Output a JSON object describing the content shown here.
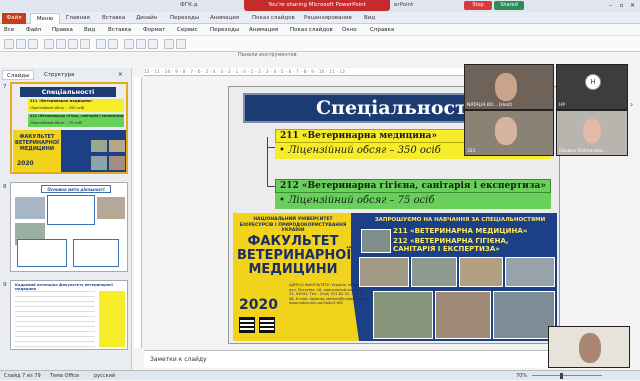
{
  "window": {
    "title": "ФГК.д",
    "title_suffix": "erPoint",
    "share_banner": "You're sharing Microsoft PowerPoint",
    "stop_label": "Stop",
    "shared_label": "Shared"
  },
  "ribbon": {
    "file": "Файл",
    "tabs": [
      "Меню",
      "Главная",
      "Вставка",
      "Дизайн",
      "Переходы",
      "Анимация",
      "Показ слайдов",
      "Рецензирование",
      "Вид"
    ]
  },
  "menu": {
    "items": [
      "Все",
      "Файл",
      "Правка",
      "Вид",
      "Вставка",
      "Формат",
      "Сервис",
      "Переходы",
      "Анимация",
      "Показ слайдов",
      "Окно",
      "Справка"
    ]
  },
  "toolbar": {
    "panel_label": "Панели инструментов"
  },
  "slides_panel": {
    "tabs": [
      "Слайды",
      "Структура"
    ],
    "numbers": [
      "7",
      "8",
      "9"
    ],
    "thumb7": {
      "title": "Спеціальності",
      "line1": "211 «Ветеринарна медицина»",
      "line2": "Ліцензійний обсяг – 350 осіб",
      "line3": "212 «Ветеринарна гігієна, санітарія і експертиза»",
      "line4": "Ліцензійний обсяг – 75 осіб",
      "fac": "ФАКУЛЬТЕТ ВЕТЕРИНАРНОЇ МЕДИЦИНИ",
      "year": "2020"
    },
    "thumb8": {
      "title": "Основна мета діяльності"
    },
    "thumb9": {
      "title": "Кадровий потенціал факультету ветеринарної медицини"
    }
  },
  "ruler": {
    "marks": "12 · 11 · 10 · 9 · 8 · 7 · 6 · 5 · 4 · 3 · 2 · 1 · 0 · 1 · 2 · 3 · 4 · 5 · 6 · 7 · 8 · 9 · 10 · 11 · 12"
  },
  "slide": {
    "title": "Спеціальності",
    "spec1_title": "211 «Ветеринарна медицина»",
    "spec1_sub": "• Ліцензійний обсяг – 350 осіб",
    "spec2_title": "212 «Ветеринарна гігієна, санітарія і експертиза»",
    "spec2_sub": "• Ліцензійний обсяг – 75 осіб",
    "poster": {
      "university": "НАЦІОНАЛЬНИЙ УНІВЕРСИТЕТ БІОРЕСУРСІВ І ПРИРОДОКОРИСТУВАННЯ УКРАЇНИ",
      "faculty": "ФАКУЛЬТЕТ ВЕТЕРИНАРНОЇ МЕДИЦИНИ",
      "year": "2020",
      "invite": "ЗАПРОШУЄМО НА НАВЧАННЯ ЗА СПЕЦІАЛЬНОСТЯМИ",
      "spec211": "211 «ВЕТЕРИНАРНА МЕДИЦИНА»",
      "spec212": "212 «ВЕТЕРИНАРНА ГІГІЄНА, САНІТАРІЯ І ЕКСПЕРТИЗА»",
      "address": "АДРЕСА ФАКУЛЬТЕТУ: Україна, м. Київ, вул. Потєхіна, 16, навчальний корпус № 12, 03041, Тел.: (044) 527-82-31, 527-82-58, E-mail: dekanat_vetmed@nubip.edu.ua, www.nubip.edu.ua/node/1160"
    }
  },
  "notes": {
    "placeholder": "Заметки к слайду"
  },
  "video": {
    "p1": "NATALIA KO... (Host)",
    "p2": "HP",
    "p2_initial": "H",
    "p3": "321",
    "p4": "Oksana Vishnevska..."
  },
  "status": {
    "slide_of": "Слайд 7 из 79",
    "theme": "Тема Office",
    "lang": "русский",
    "zoom": "70%"
  }
}
